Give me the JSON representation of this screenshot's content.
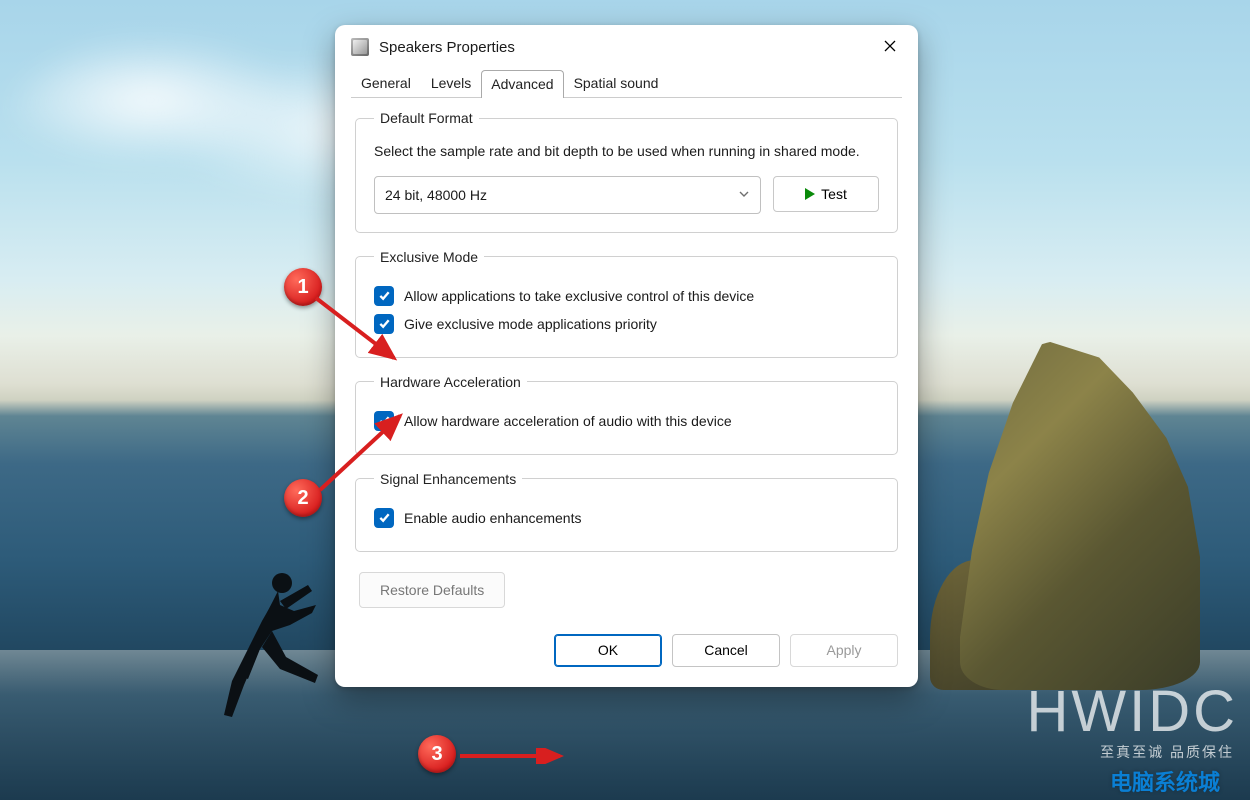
{
  "window": {
    "title": "Speakers Properties"
  },
  "tabs": {
    "general": "General",
    "levels": "Levels",
    "advanced": "Advanced",
    "spatial": "Spatial sound",
    "active": "advanced"
  },
  "default_format": {
    "legend": "Default Format",
    "description": "Select the sample rate and bit depth to be used when running in shared mode.",
    "selected": "24 bit, 48000 Hz",
    "test_label": "Test"
  },
  "exclusive_mode": {
    "legend": "Exclusive Mode",
    "allow_label": "Allow applications to take exclusive control of this device",
    "allow_checked": true,
    "priority_label": "Give exclusive mode applications priority",
    "priority_checked": true
  },
  "hardware_accel": {
    "legend": "Hardware Acceleration",
    "allow_label": "Allow hardware acceleration of audio with this device",
    "allow_checked": true
  },
  "signal_enh": {
    "legend": "Signal Enhancements",
    "enable_label": "Enable audio enhancements",
    "enable_checked": true
  },
  "restore_label": "Restore Defaults",
  "footer": {
    "ok": "OK",
    "cancel": "Cancel",
    "apply": "Apply"
  },
  "annotations": {
    "one": "1",
    "two": "2",
    "three": "3"
  },
  "watermark": {
    "big": "HWIDC",
    "cn": "至真至诚 品质保住",
    "logo": "电脑系统城"
  }
}
